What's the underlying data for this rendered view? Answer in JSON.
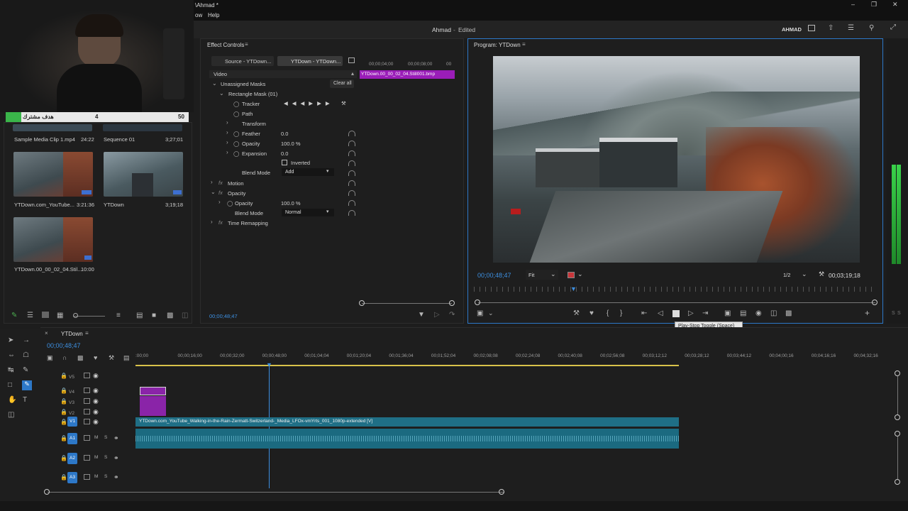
{
  "window": {
    "title": "\\Ahmad *",
    "menu_items": [
      "ow",
      "Help"
    ]
  },
  "header": {
    "project": "Ahmad",
    "status": "Edited",
    "user": "AHMAD"
  },
  "overlay": {
    "label": "هدف مشترك",
    "current": "4",
    "goal": "50"
  },
  "project_panel": {
    "items": [
      {
        "name": "Sample Media Clip 1.mp4",
        "duration": "24:22"
      },
      {
        "name": "Sequence 01",
        "duration": "3;27;01"
      },
      {
        "name": "YTDown.com_YouTube...",
        "duration": "3:21:36"
      },
      {
        "name": "YTDown",
        "duration": "3;19;18"
      },
      {
        "name": "YTDown.00_00_02_04.Stil...",
        "duration": "10:00"
      }
    ]
  },
  "effect_controls": {
    "tab": "Effect Controls",
    "source_label": "Source - YTDown...",
    "sequence_label": "YTDown - YTDown...",
    "ruler": [
      "00;00;04;00",
      "00;00;08;00",
      "00"
    ],
    "clip_label": "YTDown.00_00_02_04.Still001.bmp",
    "section_video": "Video",
    "unassigned": "Unassigned Masks",
    "clear_all": "Clear all",
    "mask_name": "Rectangle Mask (01)",
    "tracker": "Tracker",
    "path": "Path",
    "transform": "Transform",
    "feather_label": "Feather",
    "feather_value": "0.0",
    "opacity_label": "Opacity",
    "opacity_value": "100.0 %",
    "expansion_label": "Expansion",
    "expansion_value": "0.0",
    "inverted_label": "Inverted",
    "blend_label": "Blend Mode",
    "blend_value": "Add",
    "motion": "Motion",
    "opacity_section": "Opacity",
    "opacity2_label": "Opacity",
    "opacity2_value": "100.0 %",
    "blend2_label": "Blend Mode",
    "blend2_value": "Normal",
    "time_remap": "Time Remapping",
    "timecode": "00;00;48;47"
  },
  "program": {
    "tab": "Program: YTDown",
    "timecode": "00;00;48;47",
    "fit": "Fit",
    "resolution": "1/2",
    "duration": "00;03;19;18",
    "tooltip": "Play-Stop Toggle (Space)"
  },
  "timeline": {
    "tab": "YTDown",
    "timecode": "00;00;48;47",
    "ruler": [
      ":00;00",
      "00;00;16;00",
      "00;00;32;00",
      "00;00;48;00",
      "00;01;04;04",
      "00;01;20;04",
      "00;01;36;04",
      "00;01;52;04",
      "00;02;08;08",
      "00;02;24;08",
      "00;02;40;08",
      "00;02;56;08",
      "00;03;12;12",
      "00;03;28;12",
      "00;03;44;12",
      "00;04;00;16",
      "00;04;16;16",
      "00;04;32;16"
    ],
    "video_tracks": [
      "V5",
      "V4",
      "V3",
      "V2",
      "V1"
    ],
    "audio_tracks": [
      "A1",
      "A2",
      "A3"
    ],
    "clip_label": "YTDown.com_YouTube_Walking-in-the-Rain-Zermatt-Switzerland-_Media_LFOx-vmYrts_001_1080p-extended [V]"
  },
  "meter": {
    "labels": [
      "S",
      "S"
    ]
  },
  "colors": {
    "accent": "#3d8fe0",
    "clip_video": "#1f6f86",
    "clip_purple": "#8a24a8"
  }
}
